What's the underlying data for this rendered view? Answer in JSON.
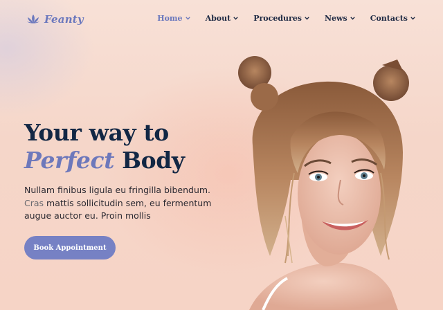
{
  "brand": {
    "name": "Feanty",
    "icon": "lotus-icon",
    "color": "#6b78bd"
  },
  "nav": {
    "items": [
      {
        "label": "Home",
        "active": true
      },
      {
        "label": "About",
        "active": false
      },
      {
        "label": "Procedures",
        "active": false
      },
      {
        "label": "News",
        "active": false
      },
      {
        "label": "Contacts",
        "active": false
      }
    ],
    "dropdown_icon": "chevron-down-icon"
  },
  "hero": {
    "title_line1": "Your way to",
    "title_accent": "Perfect",
    "title_end": "Body",
    "text_main": "Nullam finibus ligula eu fringilla bibendum.",
    "text_muted": "Cras",
    "text_rest": "mattis sollicitudin sem, eu fermentum augue auctor eu. Proin mollis",
    "cta_label": "Book Appointment"
  },
  "colors": {
    "accent": "#6d78bb",
    "heading": "#122744",
    "button": "#7681c4",
    "background": "#f6d9cd"
  }
}
